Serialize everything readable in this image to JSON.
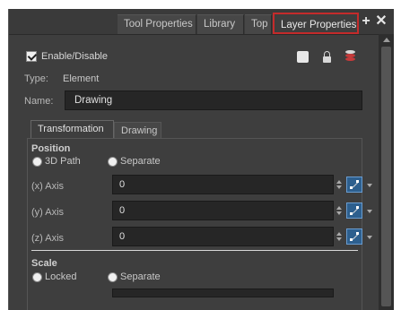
{
  "tabs": {
    "tool_properties": "Tool Properties",
    "library": "Library",
    "top": "Top",
    "layer_properties": "Layer Properties"
  },
  "panel": {
    "enable_label": "Enable/Disable",
    "type_label": "Type:",
    "type_value": "Element",
    "name_label": "Name:",
    "name_value": "Drawing"
  },
  "subtabs": {
    "transformation": "Transformation",
    "drawing": "Drawing"
  },
  "position": {
    "title": "Position",
    "option_3d": "3D Path",
    "option_separate": "Separate",
    "x_label": "(x) Axis",
    "x_value": "0",
    "y_label": "(y) Axis",
    "y_value": "0",
    "z_label": "(z) Axis",
    "z_value": "0"
  },
  "scale": {
    "title": "Scale",
    "option_locked": "Locked",
    "option_separate": "Separate"
  },
  "colors": {
    "highlight": "#c42b2b",
    "function_button": "#2d5f8e"
  }
}
